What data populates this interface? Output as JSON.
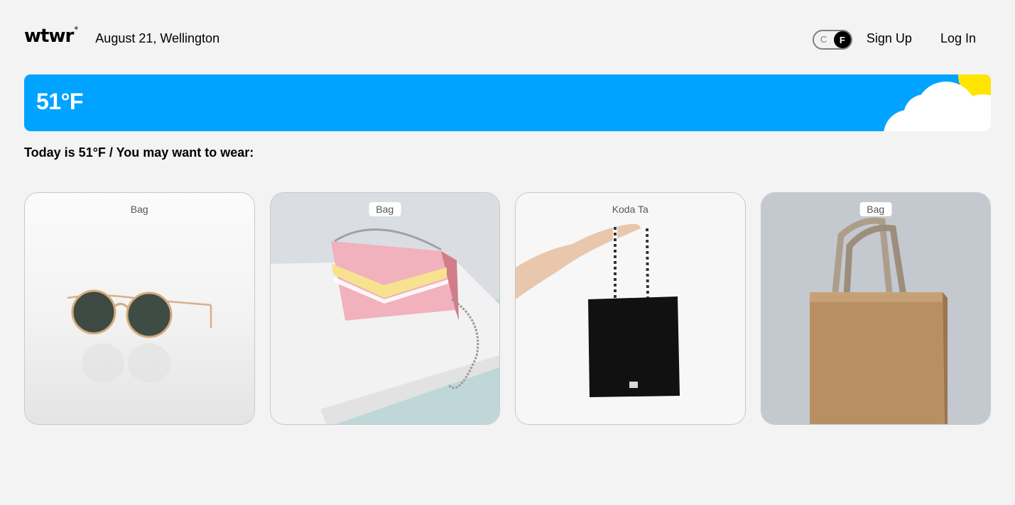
{
  "header": {
    "logo": "wtwr",
    "logo_degree": "°",
    "date_location": "August 21, Wellington",
    "toggle": {
      "off_label": "C",
      "on_label": "F",
      "selected": "F"
    },
    "signup_label": "Sign Up",
    "login_label": "Log In"
  },
  "weather": {
    "temperature": "51°F",
    "condition_icons": [
      "sun-icon",
      "cloud-icon"
    ],
    "colors": {
      "background": "#00a3ff",
      "sun": "#ffe500",
      "cloud": "#ffffff"
    }
  },
  "main": {
    "subtitle": "Today is 51°F / You may want to wear:"
  },
  "cards": [
    {
      "name": "Bag",
      "image": "sunglasses"
    },
    {
      "name": "Bag",
      "image": "pink-crossbody-bag"
    },
    {
      "name": "Koda Ta",
      "image": "black-tote-bag"
    },
    {
      "name": "Bag",
      "image": "brown-shopping-bag"
    }
  ]
}
